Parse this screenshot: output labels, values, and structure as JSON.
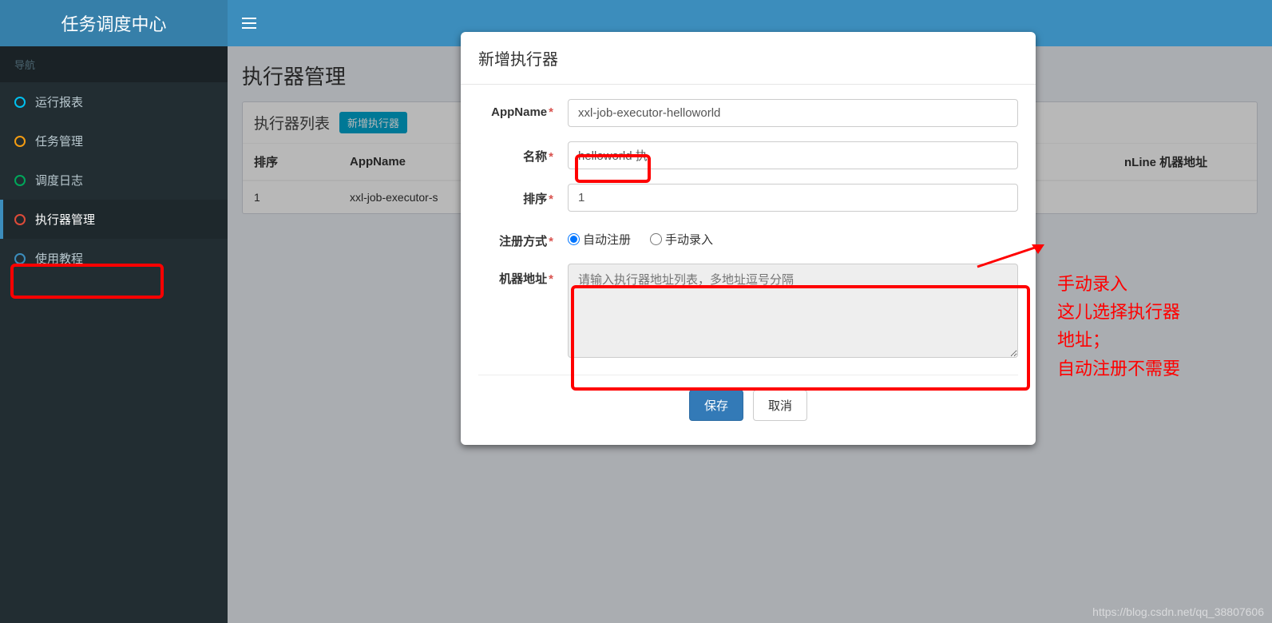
{
  "header": {
    "logo": "任务调度中心"
  },
  "sidebar": {
    "header": "导航",
    "items": [
      {
        "label": "运行报表"
      },
      {
        "label": "任务管理"
      },
      {
        "label": "调度日志"
      },
      {
        "label": "执行器管理"
      },
      {
        "label": "使用教程"
      }
    ]
  },
  "page": {
    "title": "执行器管理",
    "panel_title": "执行器列表",
    "add_button": "新增执行器"
  },
  "table": {
    "headers": {
      "sort": "排序",
      "appname": "AppName",
      "online": "nLine 机器地址"
    },
    "rows": [
      {
        "sort": "1",
        "appname": "xxl-job-executor-s"
      }
    ]
  },
  "modal": {
    "title": "新增执行器",
    "labels": {
      "appname": "AppName",
      "name": "名称",
      "sort": "排序",
      "reg_type": "注册方式",
      "address": "机器地址"
    },
    "values": {
      "appname": "xxl-job-executor-helloworld",
      "name": "helloworld 执",
      "sort": "1",
      "address_placeholder": "请输入执行器地址列表，多地址逗号分隔"
    },
    "radio": {
      "auto": "自动注册",
      "manual": "手动录入"
    },
    "buttons": {
      "save": "保存",
      "cancel": "取消"
    }
  },
  "annotations": {
    "text1": "手动录入\n这儿选择执行器\n地址；\n自动注册不需要"
  },
  "watermark": "https://blog.csdn.net/qq_38807606"
}
